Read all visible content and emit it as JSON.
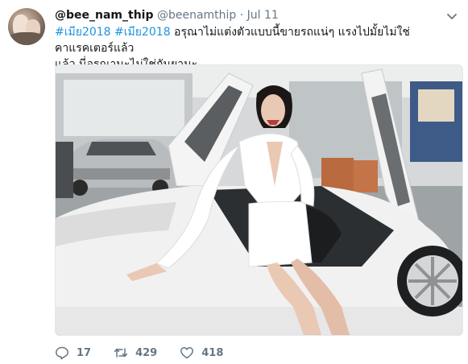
{
  "tweet": {
    "display_name": "@bee_nam_thip",
    "handle": "@beenamthip",
    "separator": "·",
    "date": "Jul 11",
    "hashtags": [
      "#เมีย2018",
      "#เมีย2018"
    ],
    "text_after_hashtags": " อรุณาไม่แต่งตัวแบบนี้ขายรถแน่ๆ แรงไปมั้ยไม่ใช่คาแรคเตอร์แล้ว",
    "text_line2": "แล้ว นี่อรุณานะไม่ใช่กันยานะ"
  },
  "actions": {
    "replies": "17",
    "retweets": "429",
    "likes": "418"
  },
  "icons": {
    "reply": "reply-icon",
    "retweet": "retweet-icon",
    "like": "heart-icon",
    "menu": "chevron-down-icon"
  },
  "colors": {
    "hashtag": "#1b95e0",
    "secondary_text": "#657786",
    "car_white": "#f2f2f2"
  }
}
